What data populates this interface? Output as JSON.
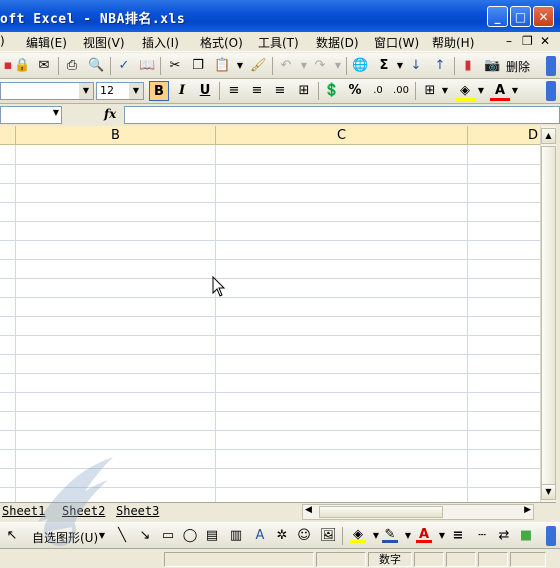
{
  "window": {
    "title": "oft Excel - NBA排名.xls",
    "controls": [
      "_",
      "□",
      "✕"
    ]
  },
  "menu": {
    "items": [
      "编辑(E)",
      "视图(V)",
      "插入(I)",
      "格式(O)",
      "工具(T)",
      "数据(D)",
      "窗口(W)",
      "帮助(H)"
    ],
    "window_controls": [
      "–",
      "❐",
      "✕"
    ],
    "left_fragment": ")"
  },
  "standard_toolbar": {
    "delete_label": "删除",
    "sum_icon": "Σ"
  },
  "format_toolbar": {
    "font_size": "12",
    "bold": "B",
    "italic": "I",
    "underline": "U",
    "percent": "%",
    "font_color": "A"
  },
  "formula_bar": {
    "fx_label": "fx",
    "name_value": "",
    "formula_value": ""
  },
  "grid": {
    "columns": [
      "B",
      "C",
      "D"
    ],
    "row_count": 18
  },
  "sheets": {
    "tabs": [
      "Sheet1",
      "Sheet2",
      "Sheet3"
    ],
    "active": "Sheet1"
  },
  "draw_toolbar": {
    "autoshapes_label": "自选图形(U)"
  },
  "status": {
    "mode_text": "数字"
  },
  "colors": {
    "titlebar": "#0a53d6",
    "col_header_bg": "#ffefbf",
    "gridline": "#d0d7e5"
  }
}
